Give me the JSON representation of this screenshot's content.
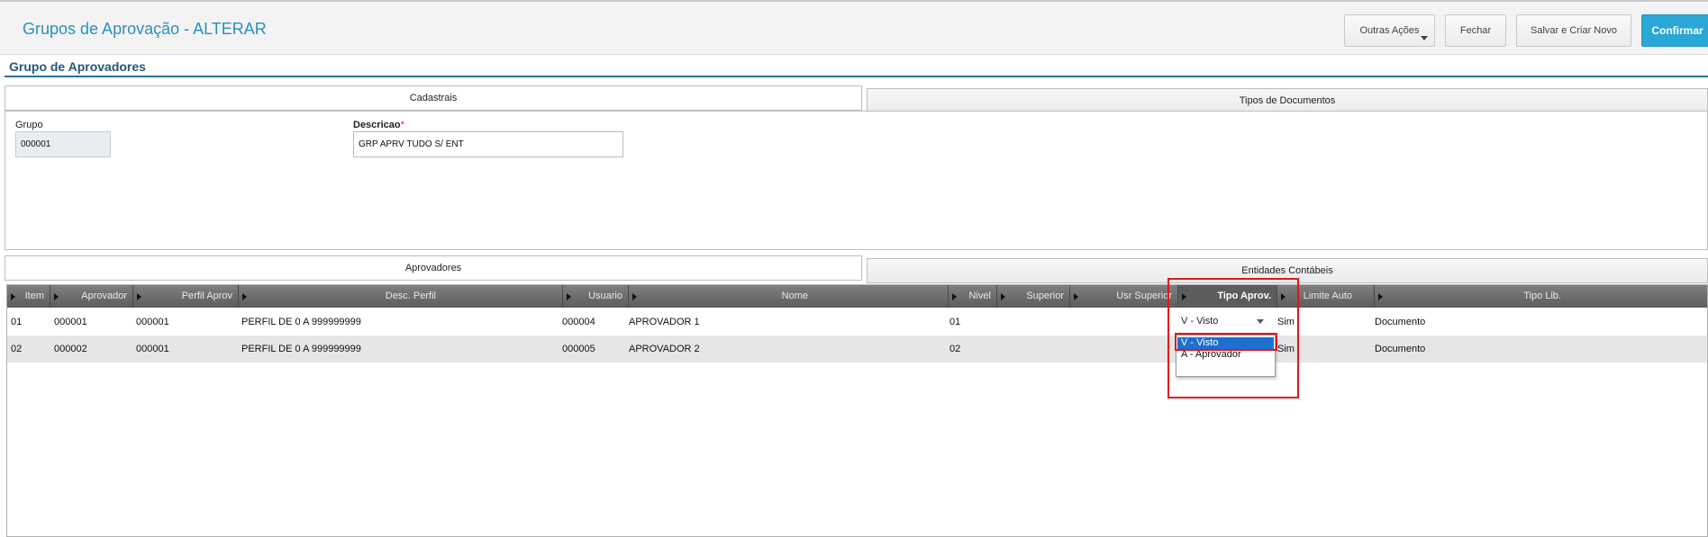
{
  "header": {
    "title": "Grupos de Aprovação - ALTERAR",
    "buttons": {
      "outras": "Outras Ações",
      "fechar": "Fechar",
      "salvar": "Salvar e Criar Novo",
      "confirmar": "Confirmar"
    }
  },
  "section_title": "Grupo de Aprovadores",
  "top_tabs": [
    "Cadastrais",
    "Tipos de Documentos"
  ],
  "form": {
    "grupo_label": "Grupo",
    "grupo_value": "000001",
    "descricao_label": "Descricao",
    "descricao_required": "*",
    "descricao_value": "GRP APRV TUDO S/ ENT"
  },
  "bottom_tabs": [
    "Aprovadores",
    "Entidades Contábeis"
  ],
  "grid": {
    "columns": [
      "Item",
      "Aprovador",
      "Perfil Aprov",
      "Desc. Perfil",
      "Usuario",
      "Nome",
      "Nivel",
      "Superior",
      "Usr Superior",
      "Tipo Aprov.",
      "Limite Auto",
      "Tipo Lib."
    ],
    "rows": [
      {
        "item": "01",
        "aprovador": "000001",
        "perfil": "000001",
        "desc_perfil": "PERFIL DE 0 A 999999999",
        "usuario": "000004",
        "nome": "APROVADOR 1",
        "nivel": "01",
        "superior": "",
        "usr_superior": "",
        "tipo_aprov": "V - Visto",
        "limite_auto": "Sim",
        "tipo_lib": "Documento"
      },
      {
        "item": "02",
        "aprovador": "000002",
        "perfil": "000001",
        "desc_perfil": "PERFIL DE 0 A 999999999",
        "usuario": "000005",
        "nome": "APROVADOR 2",
        "nivel": "02",
        "superior": "",
        "usr_superior": "",
        "tipo_aprov": "",
        "limite_auto": "Sim",
        "tipo_lib": "Documento"
      }
    ]
  },
  "dropdown": {
    "selected": "V - Visto",
    "options": [
      "V - Visto",
      "A - Aprovador"
    ]
  },
  "colors": {
    "accent": "#2a8fbf",
    "confirm": "#29a7d6",
    "highlight": "#e2161b",
    "selection": "#1f6fd1"
  }
}
